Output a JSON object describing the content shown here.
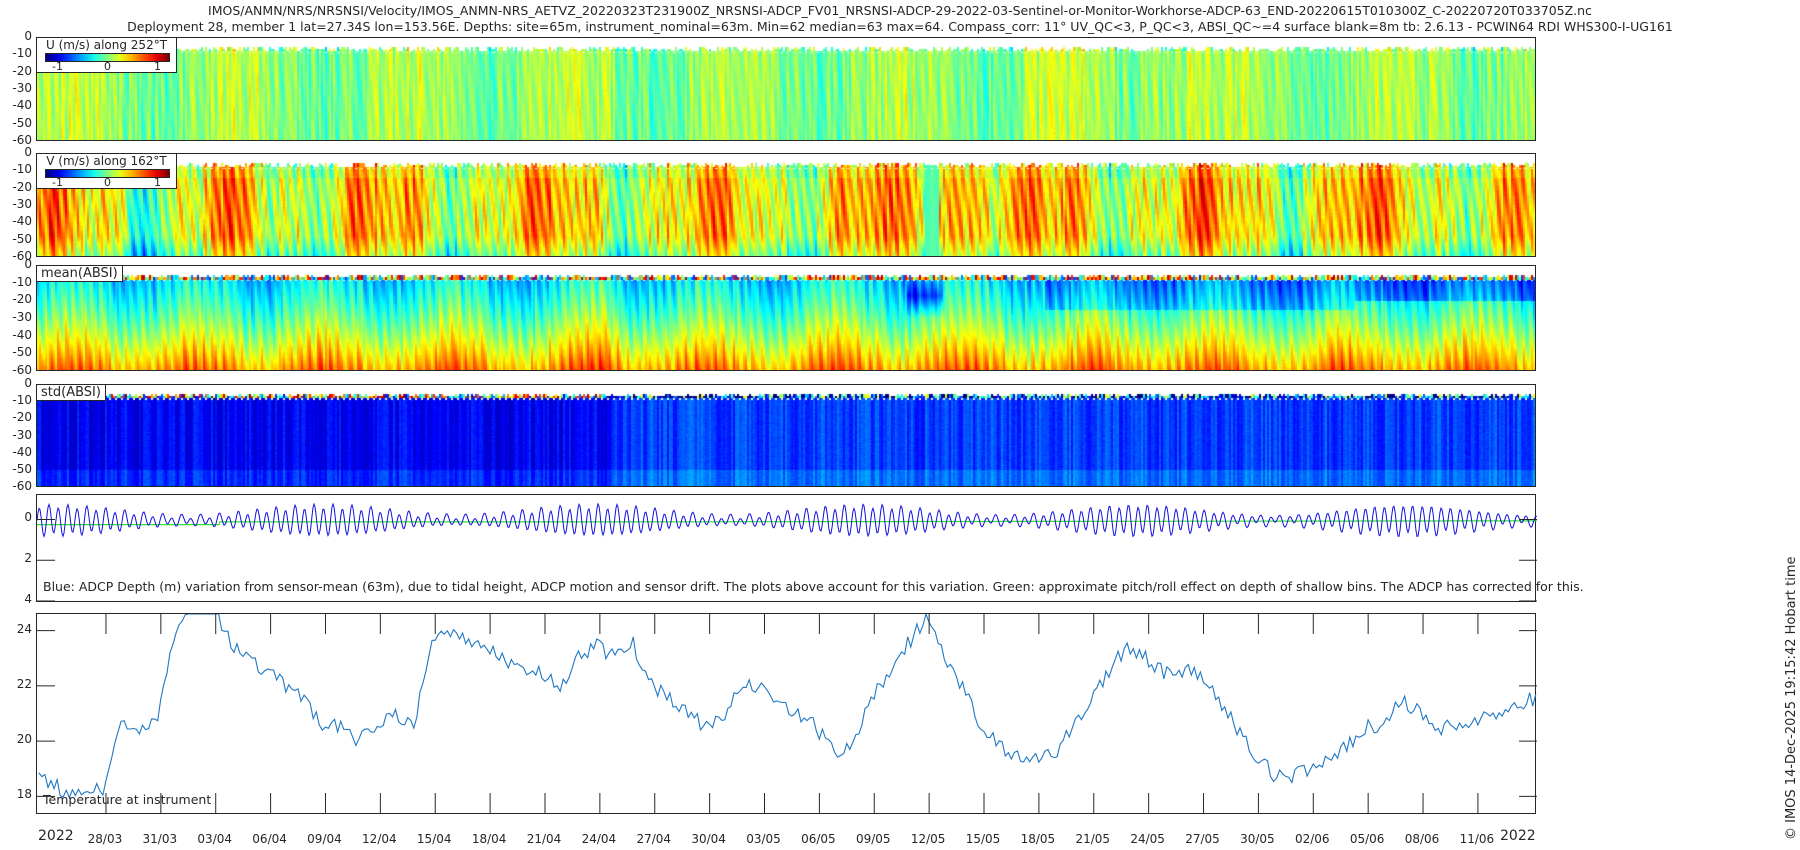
{
  "title_line1": "IMOS/ANMN/NRS/NRSNSI/Velocity/IMOS_ANMN-NRS_AETVZ_20220323T231900Z_NRSNSI-ADCP_FV01_NRSNSI-ADCP-29-2022-03-Sentinel-or-Monitor-Workhorse-ADCP-63_END-20220615T010300Z_C-20220720T033705Z.nc",
  "title_line2": "Deployment 28, member 1 lat=27.34S lon=153.56E. Depths: site=65m, instrument_nominal=63m. Min=62 median=63 max=64. Compass_corr: 11° UV_QC<3, P_QC<3, ABSI_QC~=4 surface blank=8m tb: 2.6.13 - PCWIN64 RDI WHS300-I-UG161",
  "side_stamp": "© IMOS 14-Dec-2025 19:15:42 Hobart time",
  "colors": {
    "depth_line": "#1010e0",
    "pitch_roll_line": "#30e030",
    "temperature_line": "#1f77c4",
    "axes": "#262626"
  },
  "chart_data": [
    {
      "type": "heatmap",
      "id": "u",
      "legend_title": "U (m/s) along 252°T",
      "colormap": "jet",
      "clim": [
        -1.25,
        1.25
      ],
      "colorbar_ticks": [
        "-1",
        "0",
        "1"
      ],
      "ylim": [
        -60,
        0
      ],
      "yticks": [
        "0",
        "-10",
        "-20",
        "-30",
        "-40",
        "-50",
        "-60"
      ]
    },
    {
      "type": "heatmap",
      "id": "v",
      "legend_title": "V (m/s) along 162°T",
      "colormap": "jet",
      "clim": [
        -1.25,
        1.25
      ],
      "colorbar_ticks": [
        "-1",
        "0",
        "1"
      ],
      "ylim": [
        -60,
        0
      ],
      "yticks": [
        "0",
        "-10",
        "-20",
        "-30",
        "-40",
        "-50",
        "-60"
      ]
    },
    {
      "type": "heatmap",
      "id": "absi_mean",
      "legend_title": "mean(ABSI)",
      "colormap": "jet",
      "ylim": [
        -60,
        0
      ],
      "yticks": [
        "0",
        "-10",
        "-20",
        "-30",
        "-40",
        "-50",
        "-60"
      ]
    },
    {
      "type": "heatmap",
      "id": "absi_std",
      "legend_title": "std(ABSI)",
      "colormap": "jet",
      "ylim": [
        -60,
        0
      ],
      "yticks": [
        "0",
        "-10",
        "-20",
        "-30",
        "-40",
        "-50",
        "-60"
      ]
    },
    {
      "type": "line",
      "id": "depth",
      "annotation": "Blue: ADCP Depth (m) variation from sensor-mean (63m), due to tidal height, ADCP motion and sensor drift. The plots above account for this variation. Green: approximate pitch/roll effect on depth of shallow bins. The ADCP has corrected for this.",
      "ylim": [
        -1.2,
        4
      ],
      "y_reversed": true,
      "yticks": [
        "0",
        "2",
        "4"
      ],
      "series": [
        {
          "color": "#1010e0",
          "description_in_plot": "Blue"
        },
        {
          "color": "#30e030",
          "description_in_plot": "Green"
        }
      ]
    },
    {
      "type": "line",
      "id": "temperature",
      "annotation": "Temperature at instrument",
      "ylim": [
        17.4,
        24.6
      ],
      "yticks": [
        "18",
        "20",
        "22",
        "24"
      ],
      "x": [
        "24/03",
        "25/03",
        "26/03",
        "27/03",
        "28/03",
        "29/03",
        "30/03",
        "31/03",
        "01/04",
        "02/04",
        "03/04",
        "04/04",
        "05/04",
        "06/04",
        "07/04",
        "08/04",
        "09/04",
        "10/04",
        "11/04",
        "12/04",
        "13/04",
        "14/04",
        "15/04",
        "16/04",
        "17/04",
        "18/04",
        "19/04",
        "20/04",
        "21/04",
        "22/04",
        "23/04",
        "24/04",
        "25/04",
        "26/04",
        "27/04",
        "28/04",
        "29/04",
        "30/04",
        "01/05",
        "02/05",
        "03/05",
        "04/05",
        "05/05",
        "06/05",
        "07/05",
        "08/05",
        "09/05",
        "10/05",
        "11/05",
        "12/05",
        "13/05",
        "14/05",
        "15/05",
        "16/05",
        "17/05",
        "18/05",
        "19/05",
        "20/05",
        "21/05",
        "22/05",
        "23/05",
        "24/05",
        "25/05",
        "26/05",
        "27/05",
        "28/05",
        "29/05",
        "30/05",
        "31/05",
        "01/06",
        "02/06",
        "03/06",
        "04/06",
        "05/06",
        "06/06",
        "07/06",
        "08/06",
        "09/06",
        "10/06",
        "11/06",
        "12/06",
        "13/06",
        "14/06",
        "15/06"
      ],
      "y": [
        19.3,
        18.5,
        18.2,
        18.2,
        18.2,
        20.6,
        20.3,
        20.8,
        24.0,
        24.8,
        24.9,
        23.5,
        23.0,
        22.5,
        22.0,
        21.5,
        20.6,
        20.5,
        20.0,
        20.5,
        21.0,
        20.5,
        23.5,
        24.0,
        23.5,
        23.5,
        23.0,
        22.5,
        22.5,
        22.0,
        23.0,
        23.5,
        23.0,
        23.5,
        22.0,
        21.5,
        21.0,
        20.5,
        21.0,
        22.0,
        22.0,
        21.5,
        21.0,
        20.5,
        19.5,
        20.0,
        21.5,
        22.5,
        23.5,
        24.5,
        23.0,
        22.0,
        20.5,
        19.8,
        19.5,
        19.3,
        19.5,
        20.5,
        21.5,
        22.5,
        23.5,
        23.0,
        22.5,
        22.5,
        22.5,
        21.5,
        20.5,
        19.5,
        18.8,
        18.7,
        19.0,
        19.5,
        19.8,
        20.5,
        20.5,
        21.5,
        21.0,
        20.5,
        20.5,
        20.8,
        21.0,
        21.2,
        21.5,
        21.5
      ]
    }
  ],
  "x_axis": {
    "year_left": "2022",
    "year_right": "2022",
    "tick_labels": [
      "28/03",
      "31/03",
      "03/04",
      "06/04",
      "09/04",
      "12/04",
      "15/04",
      "18/04",
      "21/04",
      "24/04",
      "27/04",
      "30/04",
      "03/05",
      "06/05",
      "09/05",
      "12/05",
      "15/05",
      "18/05",
      "21/05",
      "24/05",
      "27/05",
      "30/05",
      "02/06",
      "05/06",
      "08/06",
      "11/06"
    ]
  }
}
